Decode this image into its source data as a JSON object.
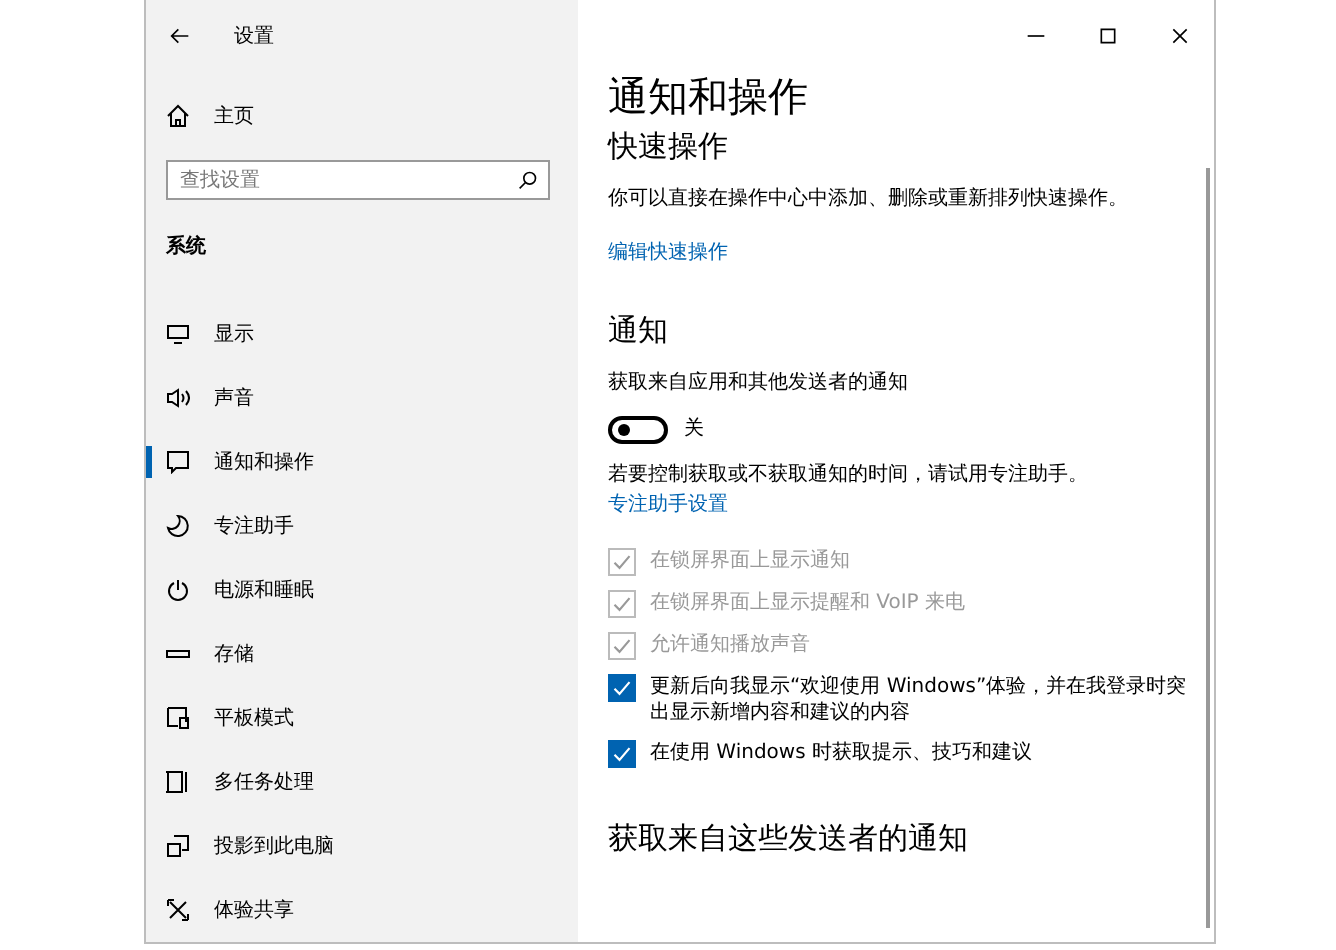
{
  "window": {
    "title": "设置"
  },
  "sidebar": {
    "home": "主页",
    "search": {
      "placeholder": "查找设置"
    },
    "section": "系统",
    "items": [
      {
        "label": "显示",
        "selected": false
      },
      {
        "label": "声音",
        "selected": false
      },
      {
        "label": "通知和操作",
        "selected": true
      },
      {
        "label": "专注助手",
        "selected": false
      },
      {
        "label": "电源和睡眠",
        "selected": false
      },
      {
        "label": "存储",
        "selected": false
      },
      {
        "label": "平板模式",
        "selected": false
      },
      {
        "label": "多任务处理",
        "selected": false
      },
      {
        "label": "投影到此电脑",
        "selected": false
      },
      {
        "label": "体验共享",
        "selected": false
      }
    ]
  },
  "main": {
    "title": "通知和操作",
    "quick_actions": {
      "heading": "快速操作",
      "description": "你可以直接在操作中心中添加、删除或重新排列快速操作。",
      "link": "编辑快速操作"
    },
    "notifications": {
      "heading": "通知",
      "toggle_label": "获取来自应用和其他发送者的通知",
      "toggle": {
        "on": false,
        "state_text": "关"
      },
      "hint": "若要控制获取或不获取通知的时间，请试用专注助手。",
      "hint_link": "专注助手设置",
      "options": [
        {
          "label": "在锁屏界面上显示通知",
          "checked": true,
          "disabled": true
        },
        {
          "label": "在锁屏界面上显示提醒和 VoIP 来电",
          "checked": true,
          "disabled": true
        },
        {
          "label": "允许通知播放声音",
          "checked": true,
          "disabled": true
        },
        {
          "label": "更新后向我显示“欢迎使用 Windows”体验，并在我登录时突出显示新增内容和建议的内容",
          "checked": true,
          "disabled": false
        },
        {
          "label": "在使用 Windows 时获取提示、技巧和建议",
          "checked": true,
          "disabled": false
        }
      ]
    },
    "senders": {
      "heading": "获取来自这些发送者的通知"
    }
  }
}
